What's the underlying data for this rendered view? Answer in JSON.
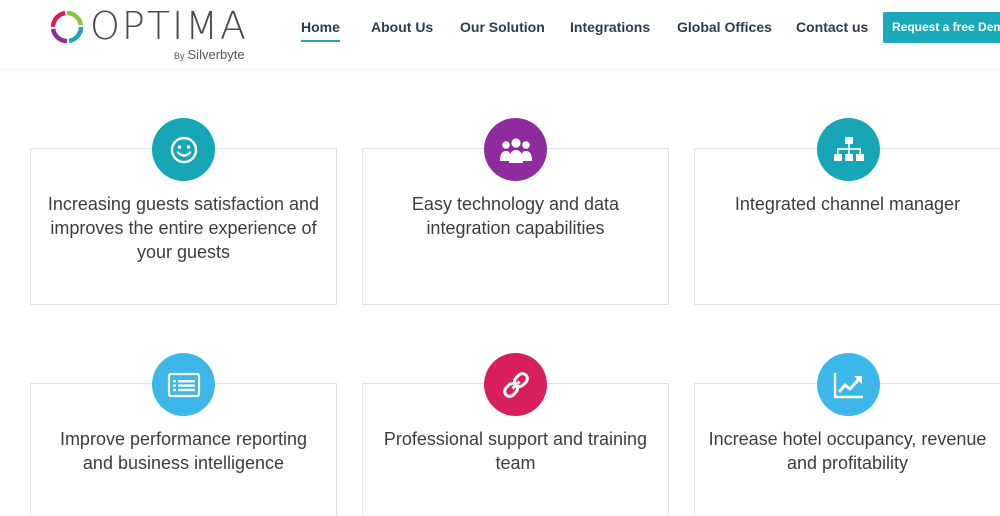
{
  "brand": {
    "name": "OPTIMA",
    "by_prefix": "By",
    "by_name": "Silverbyte"
  },
  "nav": {
    "items": [
      {
        "label": "Home",
        "active": true
      },
      {
        "label": "About Us"
      },
      {
        "label": "Our Solution"
      },
      {
        "label": "Integrations"
      },
      {
        "label": "Global Offices"
      },
      {
        "label": "Contact us"
      }
    ],
    "cta_label": "Request a free Demo"
  },
  "features": [
    {
      "text": "Increasing guests satisfaction and improves the entire experience of your guests",
      "icon": "smiley-icon",
      "color": "#17a6b5"
    },
    {
      "text": "Easy technology and data integration capabilities",
      "icon": "group-icon",
      "color": "#8e2b9d"
    },
    {
      "text": "Integrated channel manager",
      "icon": "sitemap-icon",
      "color": "#17a6b5"
    },
    {
      "text": "Improve performance reporting and business intelligence",
      "icon": "list-icon",
      "color": "#3db7ea"
    },
    {
      "text": "Professional support and training team",
      "icon": "link-icon",
      "color": "#d81e5b"
    },
    {
      "text": "Increase hotel occupancy, revenue and profitability",
      "icon": "trend-chart-icon",
      "color": "#3db7ea"
    }
  ],
  "colors": {
    "accent": "#1aa9b8",
    "nav_text": "#2f3b4a"
  }
}
